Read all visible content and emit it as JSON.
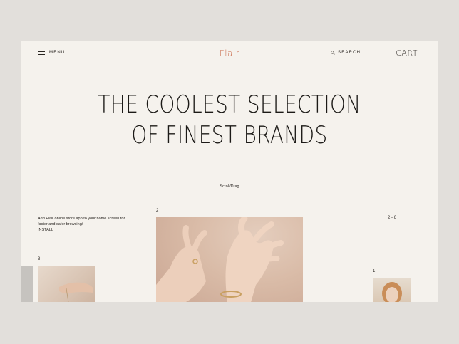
{
  "header": {
    "menu_label": "MENU",
    "logo": "Flair",
    "search_label": "SEARCH",
    "cart_label": "CART"
  },
  "hero": {
    "line1": "THE COOLEST SELECTION",
    "line2": "OF FINEST BRANDS",
    "scroll_hint": "Scroll/Drag"
  },
  "promo": {
    "text": "Add Flair online store app to your home screen for faster and safer browsing/",
    "install_label": "INSTALL"
  },
  "gallery": {
    "main_number": "2",
    "left_number": "3",
    "right_number": "1",
    "range_label": "2 - 6"
  },
  "colors": {
    "background": "#e2dfdb",
    "page": "#f5f2ed",
    "accent": "#c96a4a",
    "text": "#2a2622"
  }
}
